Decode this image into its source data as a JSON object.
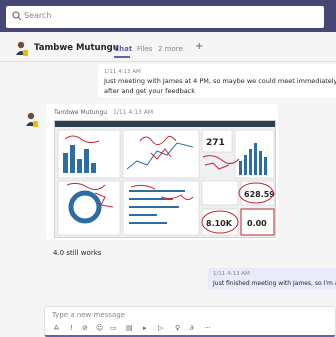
{
  "search": {
    "placeholder": "Search"
  },
  "chat": {
    "contact_name": "Tambwe Mutungu",
    "tabs": [
      {
        "label": "Chat"
      },
      {
        "label": "Files"
      },
      {
        "label": "2 more"
      },
      {
        "label": "+"
      }
    ]
  },
  "messages": [
    {
      "timestamp": "1/11 4:13 AM",
      "text": "Just meeting with James at 4 PM, so maybe we could meet immediately after and get your feedback"
    },
    {
      "sender": "Tambwe Mutungu",
      "timestamp": "1/11 4:13 AM",
      "attachment": {
        "type": "dashboard-screenshot",
        "cards": [
          {
            "value": "271"
          },
          {
            "value": "628.59"
          },
          {
            "value": "8.10K"
          },
          {
            "value": "0.00"
          }
        ]
      },
      "caption": "4.0 still works"
    },
    {
      "timestamp": "1/11 4:13 AM",
      "text": "Just finished meeting with James, so I'm a"
    }
  ],
  "composer": {
    "placeholder": "Type a new message",
    "toolbar": [
      {
        "icon": "format-icon",
        "glyph": "A"
      },
      {
        "icon": "important-icon",
        "glyph": "!"
      },
      {
        "icon": "attach-icon",
        "glyph": "⊘"
      },
      {
        "icon": "emoji-icon",
        "glyph": "☺"
      },
      {
        "icon": "gif-icon",
        "glyph": "▭"
      },
      {
        "icon": "sticker-icon",
        "glyph": "▤"
      },
      {
        "icon": "meet-icon",
        "glyph": "▸"
      },
      {
        "icon": "stream-icon",
        "glyph": "▷"
      },
      {
        "icon": "praise-icon",
        "glyph": "♀"
      },
      {
        "icon": "loop-icon",
        "glyph": "∂"
      },
      {
        "icon": "more-options-icon",
        "glyph": "···"
      }
    ]
  },
  "colors": {
    "topbar": "#464775",
    "accent": "#6264a7",
    "self_bubble": "#e8ebfa",
    "annotation": "#c4262e"
  }
}
